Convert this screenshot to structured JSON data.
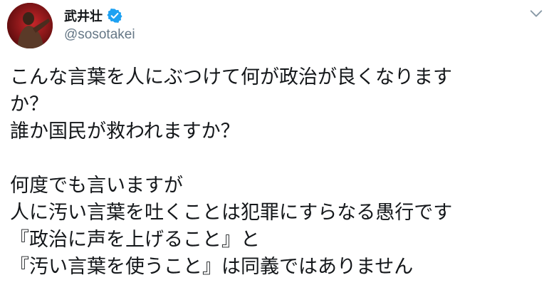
{
  "author": {
    "display_name": "武井壮",
    "handle": "@sosotakei",
    "verified": true,
    "avatar_icon": "avatar-photo"
  },
  "menu": {
    "icon": "chevron-down-icon"
  },
  "tweet": {
    "lines": [
      "こんな言葉を人にぶつけて何が政治が良くなります",
      "か？",
      "誰か国民が救われますか？",
      "",
      "何度でも言いますが",
      "人に汚い言葉を吐くことは犯罪にすらなる愚行です",
      "『政治に声を上げること』と",
      "『汚い言葉を使うこと』は同義ではありません"
    ]
  },
  "colors": {
    "text": "#14171a",
    "secondary": "#657786",
    "verified_blue": "#1da1f2",
    "chevron": "#8899a6"
  }
}
